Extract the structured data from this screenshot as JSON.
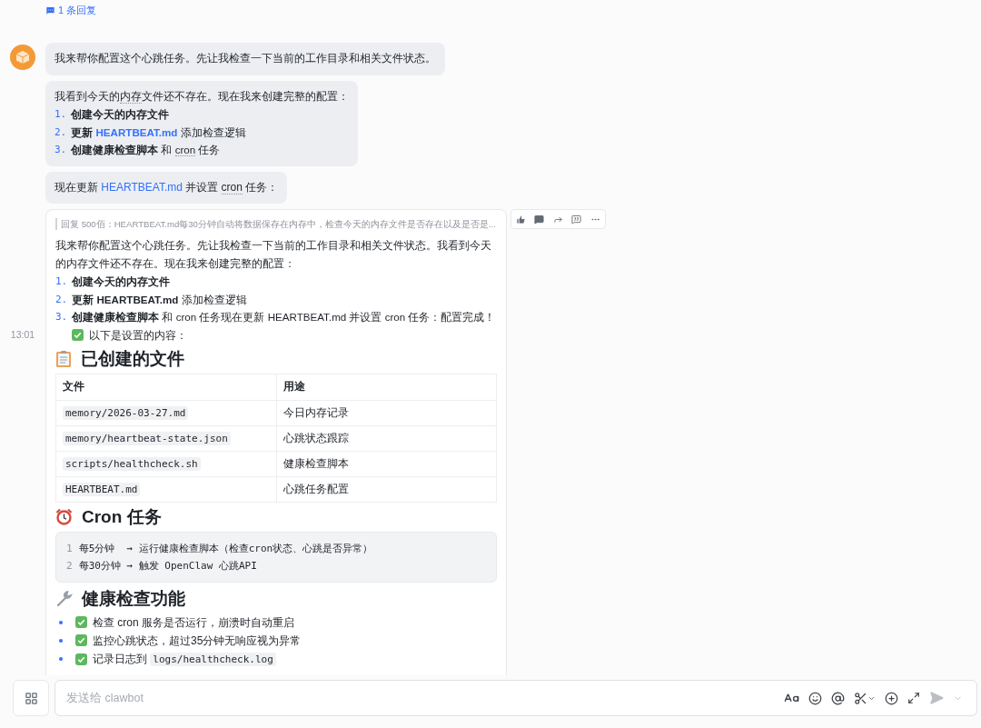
{
  "thread_reply": {
    "label": "1 条回复"
  },
  "bubbles": [
    {
      "intro": [
        {
          "kind": "plain",
          "text": "我来帮你配置这个心跳任务。先让我检查一下当前的工作目录和相关文件状态。"
        }
      ]
    },
    {
      "intro": [
        {
          "kind": "plain",
          "text": "我看到今天的"
        },
        {
          "kind": "term",
          "text": "内存"
        },
        {
          "kind": "plain",
          "text": "文件还不存在。现在我来创建完整的配置："
        }
      ],
      "items": [
        {
          "number": "1.",
          "segments": [
            {
              "kind": "bold",
              "text": "创建今天的内存文件"
            }
          ]
        },
        {
          "number": "2.",
          "segments": [
            {
              "kind": "bold",
              "text": "更新 "
            },
            {
              "kind": "bold_link",
              "text": "HEARTBEAT.md"
            },
            {
              "kind": "plain",
              "text": " 添加检查逻辑"
            }
          ]
        },
        {
          "number": "3.",
          "segments": [
            {
              "kind": "bold",
              "text": "创建健康检查脚本"
            },
            {
              "kind": "plain",
              "text": " 和 "
            },
            {
              "kind": "term",
              "text": "cron"
            },
            {
              "kind": "plain",
              "text": " 任务"
            }
          ]
        }
      ]
    },
    {
      "intro": [
        {
          "kind": "plain",
          "text": "现在更新 "
        },
        {
          "kind": "link",
          "text": "HEARTBEAT.md"
        },
        {
          "kind": "plain",
          "text": " 并设置 "
        },
        {
          "kind": "term",
          "text": "cron"
        },
        {
          "kind": "plain",
          "text": " 任务："
        }
      ]
    }
  ],
  "card": {
    "quote": "回复 500佰：HEARTBEAT.md每30分钟自动将数据保存在内存中，检查今天的内存文件是否存在以及是否是...",
    "paragraph": "我来帮你配置这个心跳任务。先让我检查一下当前的工作目录和相关文件状态。我看到今天的内存文件还不存在。现在我来创建完整的配置：",
    "items": [
      {
        "number": "1.",
        "segments": [
          {
            "kind": "bold",
            "text": "创建今天的内存文件"
          }
        ]
      },
      {
        "number": "2.",
        "segments": [
          {
            "kind": "bold",
            "text": "更新 HEARTBEAT.md"
          },
          {
            "kind": "plain",
            "text": " 添加检查逻辑"
          }
        ]
      },
      {
        "number": "3.",
        "segments": [
          {
            "kind": "bold",
            "text": "创建健康检查脚本"
          },
          {
            "kind": "plain",
            "text": " 和 cron 任务现在更新 HEARTBEAT.md 并设置 cron 任务：配置完成！"
          }
        ]
      }
    ],
    "done_note": {
      "checked": true,
      "text": "以下是设置的内容："
    },
    "sections": [
      {
        "kind": "table",
        "title": "已创建的文件",
        "columns": [
          "文件",
          "用途"
        ],
        "rows": [
          [
            "memory/2026-03-27.md",
            "今日内存记录"
          ],
          [
            "memory/heartbeat-state.json",
            "心跳状态跟踪"
          ],
          [
            "scripts/healthcheck.sh",
            "健康检查脚本"
          ],
          [
            "HEARTBEAT.md",
            "心跳任务配置"
          ]
        ]
      },
      {
        "kind": "code",
        "title": "Cron 任务",
        "lines": [
          {
            "number": "1",
            "text": "每5分钟  → 运行健康检查脚本（检查cron状态、心跳是否异常）"
          },
          {
            "number": "2",
            "text": "每30分钟 → 触发 OpenClaw 心跳API"
          }
        ]
      },
      {
        "kind": "checklist",
        "title": "健康检查功能",
        "items": [
          {
            "checked": true,
            "segments": [
              {
                "kind": "plain",
                "text": "检查 cron 服务是否运行，崩溃时自动重启"
              }
            ]
          },
          {
            "checked": true,
            "segments": [
              {
                "kind": "plain",
                "text": "监控心跳状态，超过35分钟无响应视为异常"
              }
            ]
          },
          {
            "checked": true,
            "segments": [
              {
                "kind": "plain",
                "text": "记录日志到 "
              },
              {
                "kind": "code",
                "text": "logs/healthcheck.log"
              }
            ]
          }
        ]
      }
    ]
  },
  "timestamp": "13:01",
  "composer": {
    "placeholder": "发送给 clawbot"
  }
}
